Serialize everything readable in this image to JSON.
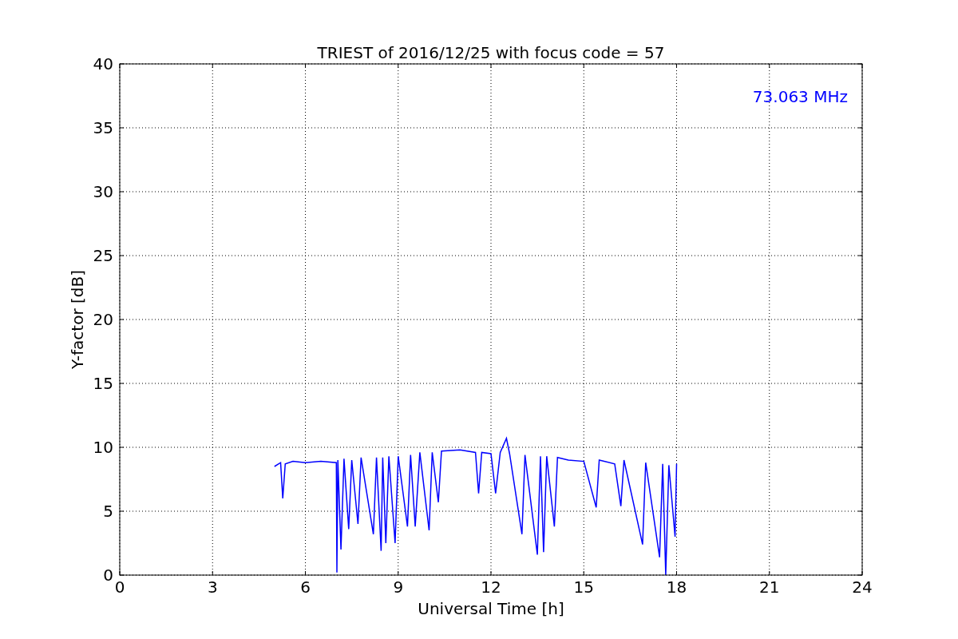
{
  "chart": {
    "chart_data": {
      "type": "line",
      "title": "TRIEST of 2016/12/25 with focus code = 57",
      "xlabel": "Universal Time [h]",
      "ylabel": "Y-factor [dB]",
      "xlim": [
        0,
        24
      ],
      "ylim": [
        0,
        40
      ],
      "xticks": [
        0,
        3,
        6,
        9,
        12,
        15,
        18,
        21,
        24
      ],
      "yticks": [
        0,
        5,
        10,
        15,
        20,
        25,
        30,
        35,
        40
      ],
      "x": [
        5.0,
        5.2,
        5.27,
        5.35,
        5.6,
        6.0,
        6.5,
        7.0,
        7.02,
        7.05,
        7.15,
        7.25,
        7.4,
        7.5,
        7.7,
        7.8,
        8.2,
        8.3,
        8.45,
        8.5,
        8.6,
        8.7,
        8.9,
        9.0,
        9.3,
        9.4,
        9.55,
        9.7,
        10.0,
        10.1,
        10.3,
        10.4,
        11.0,
        11.5,
        11.6,
        11.7,
        12.0,
        12.15,
        12.3,
        12.5,
        12.6,
        13.0,
        13.1,
        13.5,
        13.6,
        13.7,
        13.8,
        14.05,
        14.15,
        14.5,
        15.0,
        15.4,
        15.5,
        16.0,
        16.2,
        16.3,
        16.9,
        17.0,
        17.45,
        17.55,
        17.65,
        17.75,
        17.95,
        18.0
      ],
      "series": [
        {
          "color": "#0000ff",
          "values": [
            8.5,
            8.8,
            6.0,
            8.7,
            8.9,
            8.8,
            8.9,
            8.8,
            0.2,
            9.0,
            2.0,
            9.1,
            3.6,
            9.0,
            4.0,
            9.2,
            3.2,
            9.2,
            1.9,
            9.2,
            2.5,
            9.3,
            2.5,
            9.3,
            3.8,
            9.4,
            3.8,
            9.6,
            3.5,
            9.6,
            5.7,
            9.7,
            9.8,
            9.6,
            6.4,
            9.6,
            9.5,
            6.4,
            9.6,
            10.7,
            9.5,
            3.2,
            9.4,
            1.6,
            9.3,
            1.8,
            9.3,
            3.8,
            9.2,
            9.0,
            8.9,
            5.3,
            9.0,
            8.7,
            5.4,
            9.0,
            2.4,
            8.8,
            1.4,
            8.7,
            0.0,
            8.6,
            3.0,
            8.7
          ]
        }
      ],
      "grid": true,
      "annotations": [
        "73.063 MHz"
      ]
    }
  }
}
